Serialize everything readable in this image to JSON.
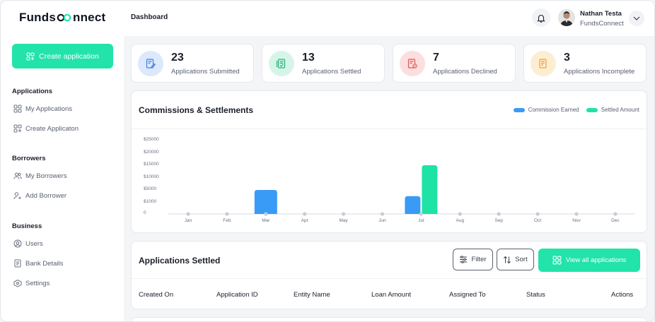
{
  "brand": {
    "prefix": "Funds",
    "suffix": "nnect"
  },
  "sidebar": {
    "create_label": "Create application",
    "sections": [
      {
        "title": "Applications",
        "items": [
          "My Applications",
          "Create Applicaton"
        ]
      },
      {
        "title": "Borrowers",
        "items": [
          "My Borrowers",
          "Add Borrower"
        ]
      },
      {
        "title": "Business",
        "items": [
          "Users",
          "Bank Details",
          "Settings"
        ]
      }
    ]
  },
  "header": {
    "title": "Dashboard",
    "user_name": "Nathan Testa",
    "user_org": "FundsConnect"
  },
  "stats": [
    {
      "value": "23",
      "label": "Applications Submitted",
      "bg": "#dce8fb",
      "fg": "#3b82e6"
    },
    {
      "value": "13",
      "label": "Applications Settled",
      "bg": "#d6f5e8",
      "fg": "#20b57a"
    },
    {
      "value": "7",
      "label": "Applications Declined",
      "bg": "#fbdede",
      "fg": "#e05555"
    },
    {
      "value": "3",
      "label": "Applications Incomplete",
      "bg": "#fdeed3",
      "fg": "#e8a53a"
    }
  ],
  "colors": {
    "accent": "#22e3a9",
    "commission": "#3a9bf7",
    "settled": "#1fe3a6"
  },
  "chart_data": {
    "type": "bar",
    "title": "Commissions & Settlements",
    "categories": [
      "Jan",
      "Feb",
      "Mar",
      "Apr",
      "May",
      "Jun",
      "Jul",
      "Aug",
      "Sep",
      "Oct",
      "Nov",
      "Dec"
    ],
    "y_tick_labels": [
      "$25000",
      "$20000",
      "$15000",
      "$10000",
      "$5000",
      "$1000",
      "0"
    ],
    "series": [
      {
        "name": "Commission Earned",
        "values": [
          0,
          0,
          5000,
          0,
          0,
          0,
          3000,
          0,
          0,
          0,
          0,
          0
        ]
      },
      {
        "name": "Settled Amount",
        "values": [
          0,
          0,
          0,
          0,
          0,
          0,
          15000,
          0,
          0,
          0,
          0,
          0
        ]
      }
    ],
    "legend": "top-right",
    "grid": false
  },
  "table": {
    "title": "Applications Settled",
    "filter_label": "Filter",
    "sort_label": "Sort",
    "view_all_label": "View all applications",
    "columns": [
      "Created On",
      "Application ID",
      "Entity Name",
      "Loan Amount",
      "Assigned To",
      "Status",
      "Actions"
    ]
  }
}
